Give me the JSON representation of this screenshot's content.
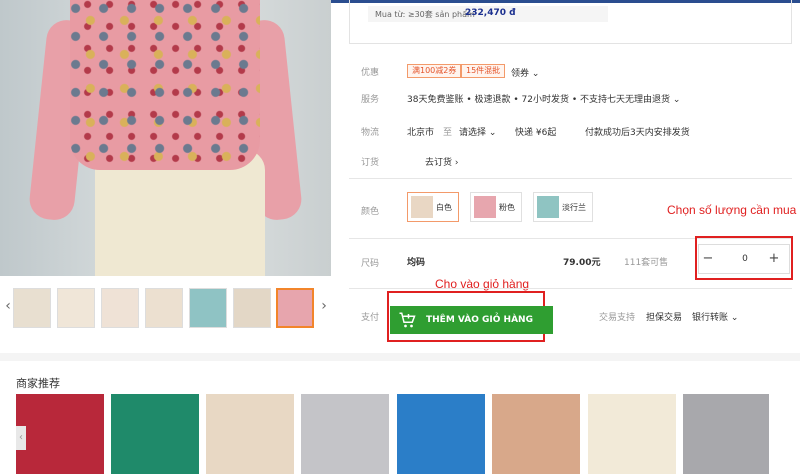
{
  "price_tier": {
    "label": "Mua từ: ≥30套 sản phẩm",
    "price": "232,470 đ"
  },
  "offers": {
    "label": "优惠",
    "tags": [
      "满100减2券",
      "15件混批"
    ],
    "coupon": "领券 ⌄"
  },
  "service": {
    "label": "服务",
    "text": "38天免费鉴账 • 极速退款 • 72小时发货 • 不支持七天无理由退货 ⌄"
  },
  "logistics": {
    "label": "物流",
    "origin": "北京市",
    "to": "至",
    "select": "请选择 ⌄",
    "express": "快递 ¥6起",
    "ship": "付款成功后3天内安排发货"
  },
  "order": {
    "label": "订货",
    "link": "去订货 ›"
  },
  "color": {
    "label": "颜色",
    "options": [
      {
        "name": "白色",
        "swatch": "#e9d7c4",
        "selected": true
      },
      {
        "name": "粉色",
        "swatch": "#e7a6ae",
        "selected": false
      },
      {
        "name": "淡行兰",
        "swatch": "#8fc4c2",
        "selected": false
      }
    ]
  },
  "size": {
    "label": "尺码",
    "name": "均码",
    "price": "79.00元",
    "stock": "111套可售"
  },
  "stepper": {
    "minus": "−",
    "value": "0",
    "plus": "+"
  },
  "annotations": {
    "qty": "Chọn số lượng cần mua",
    "cart": "Cho vào giỏ hàng"
  },
  "pay": {
    "label": "支付",
    "button": "THÊM VÀO GIỎ HÀNG",
    "trade_label": "交易支持",
    "escrow": "担保交易",
    "bank": "银行转账 ⌄"
  },
  "thumbs": {
    "prev": "‹",
    "next": "›",
    "colors": [
      "#e8dfd0",
      "#f0e6d8",
      "#efe2d6",
      "#ece0d0",
      "#8fc3c4",
      "#e3d7c6",
      "#e7a5ad"
    ],
    "active_index": 6
  },
  "recommend": {
    "title": "商家推荐",
    "items": [
      {
        "color": "#b8283a"
      },
      {
        "color": "#1f8a6a"
      },
      {
        "color": "#e8d8c4"
      },
      {
        "color": "#c4c4c8"
      },
      {
        "color": "#2b7ec8"
      },
      {
        "color": "#d8a88a"
      },
      {
        "color": "#f2ead8"
      },
      {
        "color": "#a8a8ac"
      }
    ]
  },
  "accent": {
    "brand_blue": "#1a2f8f",
    "cart_green": "#2f9e31",
    "annotation_red": "#e02020"
  }
}
